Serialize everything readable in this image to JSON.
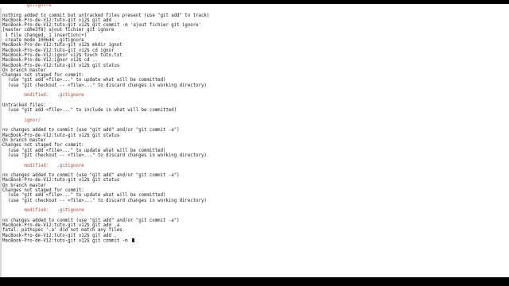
{
  "colors": {
    "background": "#ffffff",
    "text": "#1a1a1a",
    "highlight_red": "#b5462e",
    "letterbox": "#000000"
  },
  "terminal": {
    "lines": [
      {
        "text": "        .gitignore",
        "style": "red"
      },
      {
        "text": "",
        "style": "normal"
      },
      {
        "text": "nothing added to commit but untracked files present (use \"git add\" to track)",
        "style": "normal"
      },
      {
        "text": "MacBook-Pro-de-V12:tuto-git v12$ git add .",
        "style": "normal"
      },
      {
        "text": "MacBook-Pro-de-V12:tuto-git v12$ git commit -m 'ajout fichier git ignore'",
        "style": "normal"
      },
      {
        "text": "[master cd0e3f8] ajout fichier git ignore",
        "style": "normal"
      },
      {
        "text": " 1 file changed, 1 insertion(+)",
        "style": "normal"
      },
      {
        "text": " create mode 100644 .gitignore",
        "style": "normal"
      },
      {
        "text": "MacBook-Pro-de-V12:tuto-git v12$ mkdir ignot",
        "style": "normal"
      },
      {
        "text": "MacBook-Pro-de-V12:tuto-git v12$ cd ignor",
        "style": "normal"
      },
      {
        "text": "MacBook-Pro-de-V12:ignor v12$ touch tuto.txt",
        "style": "normal"
      },
      {
        "text": "MacBook-Pro-de-V12:ignor v12$ cd ..",
        "style": "normal"
      },
      {
        "text": "MacBook-Pro-de-V12:tuto-git v12$ git status",
        "style": "normal"
      },
      {
        "text": "On branch master",
        "style": "normal"
      },
      {
        "text": "Changes not staged for commit:",
        "style": "normal"
      },
      {
        "text": "  (use \"git add <file>...\" to update what will be committed)",
        "style": "normal"
      },
      {
        "text": "  (use \"git checkout -- <file>...\" to discard changes in working directory)",
        "style": "normal"
      },
      {
        "text": "",
        "style": "normal"
      },
      {
        "text": "        modified:   .gitignore",
        "style": "red"
      },
      {
        "text": "",
        "style": "normal"
      },
      {
        "text": "Untracked files:",
        "style": "normal"
      },
      {
        "text": "  (use \"git add <file>...\" to include in what will be committed)",
        "style": "normal"
      },
      {
        "text": "",
        "style": "normal"
      },
      {
        "text": "        ignor/",
        "style": "red"
      },
      {
        "text": "",
        "style": "normal"
      },
      {
        "text": "no changes added to commit (use \"git add\" and/or \"git commit -a\")",
        "style": "normal"
      },
      {
        "text": "MacBook-Pro-de-V12:tuto-git v12$ git status",
        "style": "normal"
      },
      {
        "text": "On branch master",
        "style": "normal"
      },
      {
        "text": "Changes not staged for commit:",
        "style": "normal"
      },
      {
        "text": "  (use \"git add <file>...\" to update what will be committed)",
        "style": "normal"
      },
      {
        "text": "  (use \"git checkout -- <file>...\" to discard changes in working directory)",
        "style": "normal"
      },
      {
        "text": "",
        "style": "normal"
      },
      {
        "text": "        modified:   .gitignore",
        "style": "red"
      },
      {
        "text": "",
        "style": "normal"
      },
      {
        "text": "no changes added to commit (use \"git add\" and/or \"git commit -a\")",
        "style": "normal"
      },
      {
        "text": "MacBook-Pro-de-V12:tuto-git v12$ git status",
        "style": "normal"
      },
      {
        "text": "On branch master",
        "style": "normal"
      },
      {
        "text": "Changes not staged for commit:",
        "style": "normal"
      },
      {
        "text": "  (use \"git add <file>...\" to update what will be committed)",
        "style": "normal"
      },
      {
        "text": "  (use \"git checkout -- <file>...\" to discard changes in working directory)",
        "style": "normal"
      },
      {
        "text": "",
        "style": "normal"
      },
      {
        "text": "        modified:   .gitignore",
        "style": "red"
      },
      {
        "text": "",
        "style": "normal"
      },
      {
        "text": "no changes added to commit (use \"git add\" and/or \"git commit -a\")",
        "style": "normal"
      },
      {
        "text": "MacBook-Pro-de-V12:tuto-git v12$ git add .a",
        "style": "normal"
      },
      {
        "text": "fatal: pathspec '.a' did not match any files",
        "style": "normal"
      },
      {
        "text": "MacBook-Pro-de-V12:tuto-git v12$ git add .",
        "style": "normal"
      },
      {
        "text": "MacBook-Pro-de-V12:tuto-git v12$ git commit -m ",
        "style": "prompt"
      }
    ]
  }
}
